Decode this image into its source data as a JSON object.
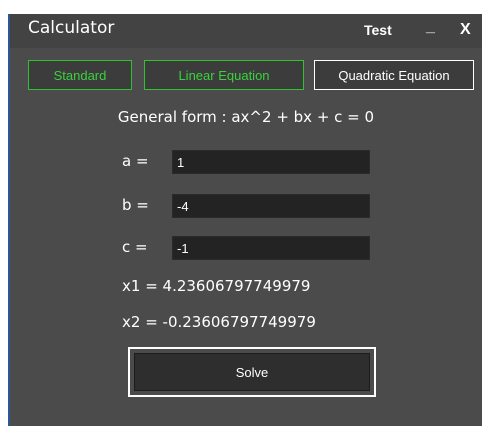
{
  "window": {
    "title": "Calculator",
    "user_label": "Test",
    "minimize_label": "_",
    "close_label": "X"
  },
  "modes": {
    "standard": "Standard",
    "linear": "Linear Equation",
    "quadratic": "Quadratic Equation",
    "selected": "Quadratic Equation"
  },
  "equation": {
    "general_form": "General form : ax^2 + bx + c = 0"
  },
  "coefficients": {
    "a": {
      "label": "a =",
      "value": "1"
    },
    "b": {
      "label": "b =",
      "value": "-4"
    },
    "c": {
      "label": "c =",
      "value": "-1"
    }
  },
  "results": {
    "x1": "x1 = 4.23606797749979",
    "x2": "x2 = -0.23606797749979"
  },
  "actions": {
    "solve_label": "Solve"
  },
  "colors": {
    "background": "#4b4b4b",
    "titlebar": "#434343",
    "accent_green": "#39d23c",
    "input_bg": "#232323",
    "text": "#ffffff"
  }
}
